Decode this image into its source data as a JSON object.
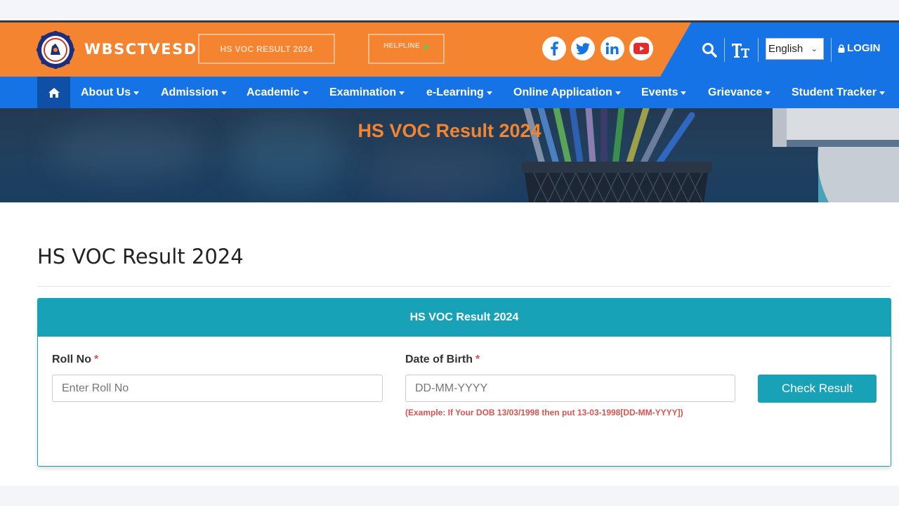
{
  "header": {
    "brand": "WBSCTVESD",
    "result_button": "HS VOC RESULT 2024",
    "helpline_button": "HELPLINE",
    "social": [
      "facebook-icon",
      "twitter-icon",
      "linkedin-icon",
      "youtube-icon"
    ],
    "language": "English",
    "login": "LOGIN",
    "colors": {
      "orange": "#f58430",
      "blue": "#1673e6",
      "teal": "#18a2b8"
    }
  },
  "nav": {
    "items": [
      {
        "label": "About Us"
      },
      {
        "label": "Admission"
      },
      {
        "label": "Academic"
      },
      {
        "label": "Examination"
      },
      {
        "label": "e-Learning"
      },
      {
        "label": "Online Application"
      },
      {
        "label": "Events"
      },
      {
        "label": "Grievance"
      },
      {
        "label": "Student Tracker"
      }
    ]
  },
  "banner": {
    "title": "HS VOC Result 2024"
  },
  "main": {
    "page_title": "HS VOC Result 2024",
    "card_title": "HS VOC Result 2024",
    "roll_label": "Roll No",
    "roll_placeholder": "Enter Roll No",
    "dob_label": "Date of Birth",
    "dob_placeholder": "DD-MM-YYYY",
    "required_mark": "*",
    "dob_hint": "(Example: If Your DOB 13/03/1998 then put 13-03-1998[DD-MM-YYYY])",
    "submit_label": "Check Result"
  }
}
